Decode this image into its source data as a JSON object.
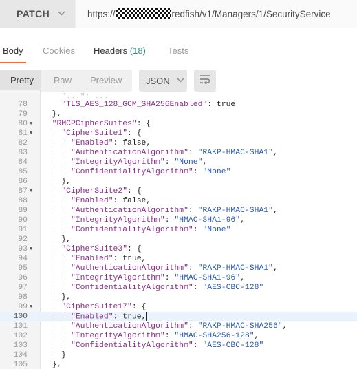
{
  "request": {
    "method": "PATCH",
    "url_prefix": "https://",
    "url_suffix": "redfish/v1/Managers/1/SecurityService"
  },
  "tabs": {
    "body": "Body",
    "cookies": "Cookies",
    "headers": "Headers",
    "headers_count": "(18)",
    "tests": "Tests"
  },
  "view": {
    "pretty": "Pretty",
    "raw": "Raw",
    "preview": "Preview",
    "format": "JSON"
  },
  "colors": {
    "accent": "#f26b3a",
    "badge": "#2a8e7e",
    "json_key": "#8a2f8a",
    "json_string": "#2a5bb3"
  },
  "code": {
    "partial_line": "    \"...\": ...",
    "lines": [
      {
        "n": "78",
        "fold": false,
        "text": "    \"TLS_AES_128_GCM_SHA256Enabled\": true"
      },
      {
        "n": "79",
        "fold": false,
        "text": "  },"
      },
      {
        "n": "80",
        "fold": true,
        "text": "  \"RMCPCipherSuites\": {"
      },
      {
        "n": "81",
        "fold": true,
        "text": "    \"CipherSuite1\": {"
      },
      {
        "n": "82",
        "fold": false,
        "text": "      \"Enabled\": false,"
      },
      {
        "n": "83",
        "fold": false,
        "text": "      \"AuthenticationAlgorithm\": \"RAKP-HMAC-SHA1\","
      },
      {
        "n": "84",
        "fold": false,
        "text": "      \"IntegrityAlgorithm\": \"None\","
      },
      {
        "n": "85",
        "fold": false,
        "text": "      \"ConfidentialityAlgorithm\": \"None\""
      },
      {
        "n": "86",
        "fold": false,
        "text": "    },"
      },
      {
        "n": "87",
        "fold": true,
        "text": "    \"CipherSuite2\": {"
      },
      {
        "n": "88",
        "fold": false,
        "text": "      \"Enabled\": false,"
      },
      {
        "n": "89",
        "fold": false,
        "text": "      \"AuthenticationAlgorithm\": \"RAKP-HMAC-SHA1\","
      },
      {
        "n": "90",
        "fold": false,
        "text": "      \"IntegrityAlgorithm\": \"HMAC-SHA1-96\","
      },
      {
        "n": "91",
        "fold": false,
        "text": "      \"ConfidentialityAlgorithm\": \"None\""
      },
      {
        "n": "92",
        "fold": false,
        "text": "    },"
      },
      {
        "n": "93",
        "fold": true,
        "text": "    \"CipherSuite3\": {"
      },
      {
        "n": "94",
        "fold": false,
        "text": "      \"Enabled\": true,"
      },
      {
        "n": "95",
        "fold": false,
        "text": "      \"AuthenticationAlgorithm\": \"RAKP-HMAC-SHA1\","
      },
      {
        "n": "96",
        "fold": false,
        "text": "      \"IntegrityAlgorithm\": \"HMAC-SHA1-96\","
      },
      {
        "n": "97",
        "fold": false,
        "text": "      \"ConfidentialityAlgorithm\": \"AES-CBC-128\""
      },
      {
        "n": "98",
        "fold": false,
        "text": "    },"
      },
      {
        "n": "99",
        "fold": true,
        "text": "    \"CipherSuite17\": {"
      },
      {
        "n": "100",
        "fold": false,
        "text": "      \"Enabled\": true,",
        "highlight": true
      },
      {
        "n": "101",
        "fold": false,
        "text": "      \"AuthenticationAlgorithm\": \"RAKP-HMAC-SHA256\","
      },
      {
        "n": "102",
        "fold": false,
        "text": "      \"IntegrityAlgorithm\": \"HMAC-SHA256-128\","
      },
      {
        "n": "103",
        "fold": false,
        "text": "      \"ConfidentialityAlgorithm\": \"AES-CBC-128\""
      },
      {
        "n": "104",
        "fold": false,
        "text": "    }"
      },
      {
        "n": "105",
        "fold": false,
        "text": "  },"
      }
    ]
  }
}
